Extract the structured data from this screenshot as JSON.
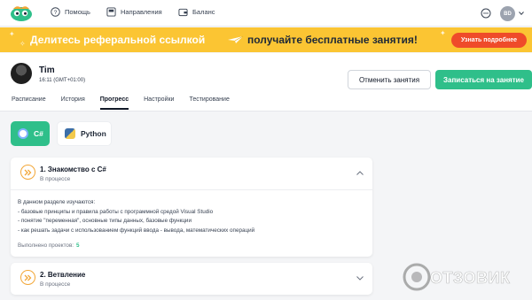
{
  "nav": {
    "help": "Помощь",
    "directions": "Направления",
    "balance": "Баланс",
    "avatar_initials": "BD"
  },
  "banner": {
    "text_part1": "Делитесь реферальной ссылкой",
    "text_part2": "получайте бесплатные занятия!",
    "button": "Узнать подробнее",
    "bg_color": "#fbc533",
    "button_color": "#ef4b2a"
  },
  "profile": {
    "name": "Tim",
    "time": "16:11 (GMT+01:00)",
    "cancel_button": "Отменить занятия",
    "enroll_button": "Записаться на занятие",
    "accent_color": "#2fbf8a"
  },
  "tabs": [
    {
      "label": "Расписание",
      "active": false
    },
    {
      "label": "История",
      "active": false
    },
    {
      "label": "Прогресс",
      "active": true
    },
    {
      "label": "Настройки",
      "active": false
    },
    {
      "label": "Тестирование",
      "active": false
    }
  ],
  "languages": [
    {
      "label": "C#",
      "selected": true
    },
    {
      "label": "Python",
      "selected": false
    }
  ],
  "modules": [
    {
      "title": "1. Знакомство с C#",
      "status": "В процессе",
      "expanded": true,
      "description": [
        "В данном разделе изучаются:",
        "- базовые принципы и правила работы с программной средой Visual Studio",
        "- понятие \"переменная\", основные типы данных, базовые функции",
        "- как решать задачи с использованием функций ввода - вывода, математических операций"
      ],
      "projects_label": "Выполнено проектов:",
      "projects_count": "5"
    },
    {
      "title": "2. Ветвление",
      "status": "В процессе",
      "expanded": false
    }
  ],
  "watermark": "ОТЗОВИК"
}
